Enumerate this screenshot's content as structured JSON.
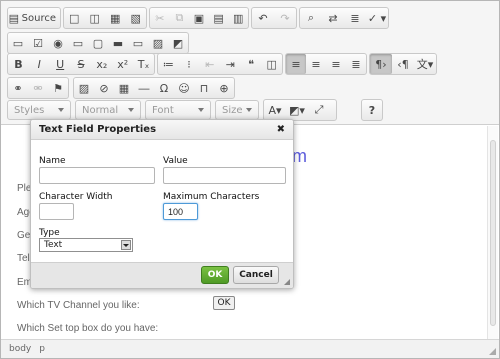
{
  "toolbar": {
    "row1": {
      "source_label": "Source"
    },
    "combos": {
      "styles": "Styles",
      "format": "Normal",
      "font": "Font",
      "size": "Size"
    },
    "help": "?"
  },
  "content": {
    "heading": "rm",
    "rows": [
      "Ple",
      "Age",
      "Ge",
      "Telp",
      "Em",
      "Which TV Channel you like:",
      "Which Set top box do you have:"
    ],
    "ok_button": "OK"
  },
  "statusbar": {
    "path": [
      "body",
      "p"
    ]
  },
  "dialog": {
    "title": "Text Field Properties",
    "close": "✖",
    "fields": {
      "name_label": "Name",
      "name_value": "",
      "value_label": "Value",
      "value_value": "",
      "char_width_label": "Character Width",
      "char_width_value": "",
      "max_chars_label": "Maximum Characters",
      "max_chars_value": "100",
      "type_label": "Type",
      "type_value": "Text"
    },
    "ok": "OK",
    "cancel": "Cancel"
  },
  "colors": {
    "ok_green": "#5aa72e",
    "heading_blue": "#5b5bdb"
  }
}
